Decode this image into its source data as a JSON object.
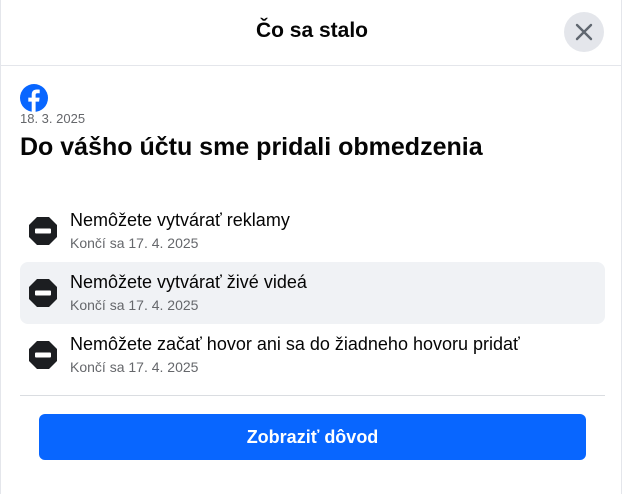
{
  "header": {
    "title": "Čo sa stalo",
    "close_icon": "close-icon"
  },
  "notice": {
    "brand_icon": "facebook-logo-icon",
    "brand_color": "#0866ff",
    "date": "18. 3. 2025",
    "headline": "Do vášho účtu sme pridali obmedzenia"
  },
  "restrictions": [
    {
      "title": "Nemôžete vytvárať reklamy",
      "ends": "Končí sa 17. 4. 2025",
      "icon": "no-entry-icon"
    },
    {
      "title": "Nemôžete vytvárať živé videá",
      "ends": "Končí sa 17. 4. 2025",
      "icon": "no-entry-icon"
    },
    {
      "title": "Nemôžete začať hovor ani sa do žiadneho hovoru pridať",
      "ends": "Končí sa 17. 4. 2025",
      "icon": "no-entry-icon"
    }
  ],
  "actions": {
    "primary_label": "Zobraziť dôvod",
    "primary_color": "#0866ff"
  }
}
